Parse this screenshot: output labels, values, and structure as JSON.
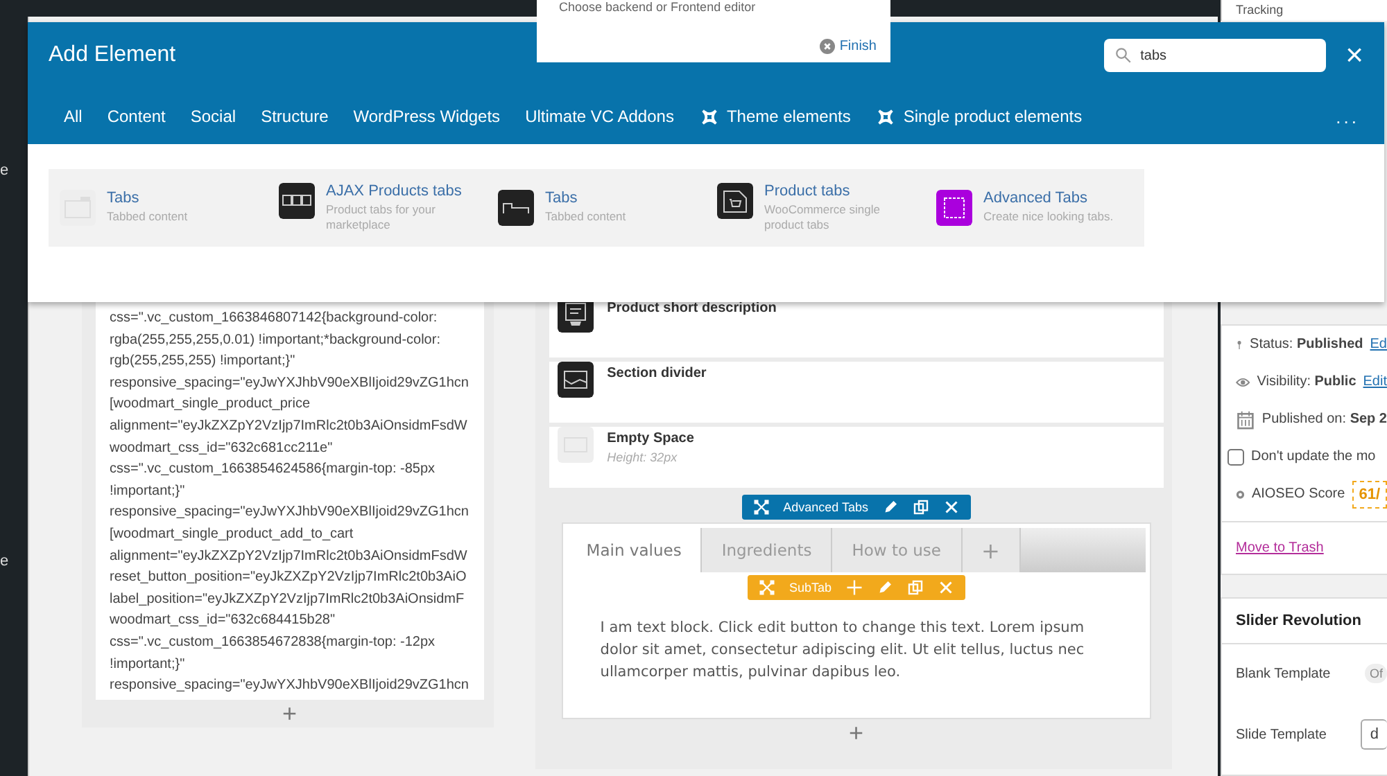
{
  "top_bar": {
    "right_text": "Tracking"
  },
  "left_menu": [
    "e",
    "e"
  ],
  "tour_popup": {
    "text": "Choose backend or Frontend editor",
    "finish": "Finish"
  },
  "modal": {
    "title": "Add Element",
    "search": {
      "value": "tabs"
    },
    "close": "×",
    "categories": [
      {
        "label": "All",
        "kind": "plain"
      },
      {
        "label": "Content",
        "kind": "plain"
      },
      {
        "label": "Social",
        "kind": "plain"
      },
      {
        "label": "Structure",
        "kind": "plain"
      },
      {
        "label": "WordPress Widgets",
        "kind": "plain"
      },
      {
        "label": "Ultimate VC Addons",
        "kind": "plain"
      },
      {
        "label": "Theme elements",
        "kind": "icon"
      },
      {
        "label": "Single product elements",
        "kind": "icon"
      }
    ],
    "more": "...",
    "results": [
      {
        "name": "Tabs",
        "description": "Tabbed content"
      },
      {
        "name": "AJAX Products tabs",
        "description": "Product tabs for your marketplace"
      },
      {
        "name": "Tabs",
        "description": "Tabbed content"
      },
      {
        "name": "Product tabs",
        "description": "WooCommerce single product tabs"
      },
      {
        "name": "Advanced Tabs",
        "description": "Create nice looking tabs."
      }
    ]
  },
  "code_block": {
    "lines": [
      "css=\".vc_custom_1663846807142{background-color:",
      "rgba(255,255,255,0.01) !important;*background-color:",
      "rgb(255,255,255) !important;}\"",
      "responsive_spacing=\"eyJwYXJhbV90eXBlIjoid29vZG1hcn",
      "[woodmart_single_product_price",
      "alignment=\"eyJkZXZpY2VzIjp7ImRlc2t0b3AiOnsidmFsdW",
      "woodmart_css_id=\"632c681cc211e\"",
      "css=\".vc_custom_1663854624586{margin-top: -85px",
      "!important;}\"",
      "responsive_spacing=\"eyJwYXJhbV90eXBlIjoid29vZG1hcn",
      "[woodmart_single_product_add_to_cart",
      "alignment=\"eyJkZXZpY2VzIjp7ImRlc2t0b3AiOnsidmFsdW",
      "reset_button_position=\"eyJkZXZpY2VzIjp7ImRlc2t0b3AiO",
      "label_position=\"eyJkZXZpY2VzIjp7ImRlc2t0b3AiOnsidmF",
      "woodmart_css_id=\"632c684415b28\"",
      "css=\".vc_custom_1663854672838{margin-top: -12px",
      "!important;}\"",
      "responsive_spacing=\"eyJwYXJhbV90eXBlIjoid29vZG1hcn"
    ],
    "add": "+"
  },
  "elements": [
    {
      "name": "Product short description",
      "kind": "cart"
    },
    {
      "name": "Section divider",
      "kind": "divider"
    },
    {
      "name": "Empty Space",
      "detail": "Height: 32px",
      "kind": "space"
    }
  ],
  "advanced_tabs_toolbar": {
    "label": "Advanced Tabs"
  },
  "tabs": [
    {
      "label": "Main values",
      "selected": true
    },
    {
      "label": "Ingredients",
      "selected": false
    },
    {
      "label": "How to use",
      "selected": false
    }
  ],
  "tab_add": "+",
  "subtab_toolbar": {
    "label": "SubTab"
  },
  "text_block": "I am text block. Click edit button to change this text. Lorem ipsum dolor sit amet, consectetur adipiscing elit. Ut elit tellus, luctus nec ullamcorper mattis, pulvinar dapibus leo.",
  "column_add": "+",
  "publish_box": {
    "status_label": "Status:",
    "status": "Published",
    "status_link": "Ed",
    "visibility_label": "Visibility:",
    "visibility": "Public",
    "visibility_link": "Edit",
    "published_label": "Published on:",
    "published": "Sep 2",
    "dont_update": {
      "label": "Don't update the mo",
      "checked": false
    },
    "aioseo_label": "AIOSEO Score",
    "aioseo_score": "61/",
    "trash": "Move to Trash"
  },
  "slider_revolution": {
    "title": "Slider Revolution",
    "blank_template_label": "Blank Template",
    "blank_template_toggle": "Of",
    "blank_template_on": false,
    "slide_template_label": "Slide Template",
    "slide_template_value": "d"
  }
}
